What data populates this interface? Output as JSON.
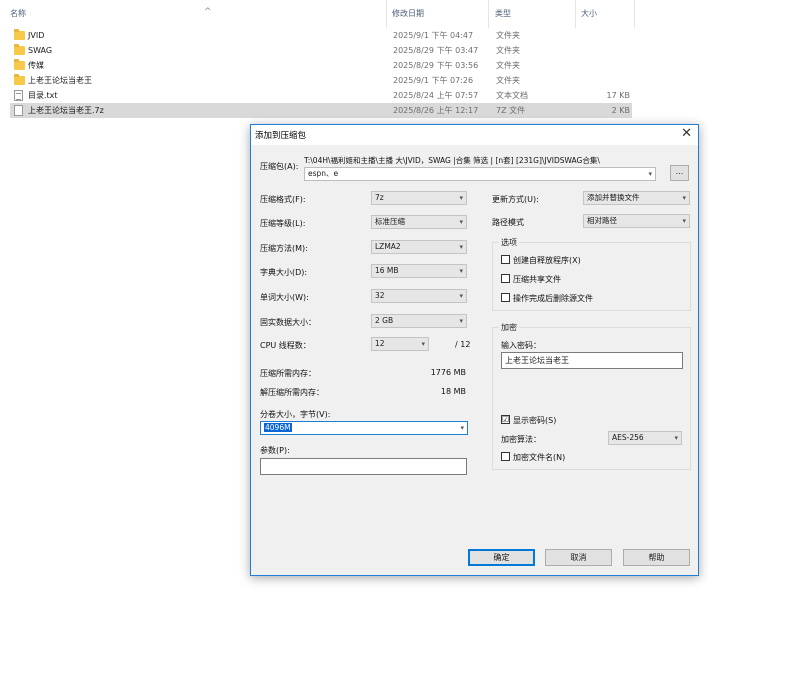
{
  "explorer": {
    "columns": {
      "name": "名称",
      "date": "修改日期",
      "type": "类型",
      "size": "大小"
    },
    "files": [
      {
        "name": "JVID",
        "date": "2025/9/1 下午 04:47",
        "type": "文件夹",
        "size": "",
        "icon": "folder-icon"
      },
      {
        "name": "SWAG",
        "date": "2025/8/29 下午 03:47",
        "type": "文件夹",
        "size": "",
        "icon": "folder-icon"
      },
      {
        "name": "传媒",
        "date": "2025/8/29 下午 03:56",
        "type": "文件夹",
        "size": "",
        "icon": "folder-icon"
      },
      {
        "name": "上老王论坛当老王",
        "date": "2025/9/1 下午 07:26",
        "type": "文件夹",
        "size": "",
        "icon": "folder-icon"
      },
      {
        "name": "目录.txt",
        "date": "2025/8/24 上午 07:57",
        "type": "文本文档",
        "size": "17 KB",
        "icon": "text-file-icon"
      },
      {
        "name": "上老王论坛当老王.7z",
        "date": "2025/8/26 上午 12:17",
        "type": "7Z 文件",
        "size": "2 KB",
        "icon": "archive-file-icon",
        "selected": true
      }
    ]
  },
  "dialog": {
    "title": "添加到压缩包",
    "archive_label": "压缩包(A):",
    "archive_path": "T:\\04H\\福利姬和主播\\主播 大\\JVID，SWAG |合集 筛选 | [n套] [231G]\\JVIDSWAG合集\\",
    "archive_name": "espn、e",
    "browse_label": "...",
    "format_label": "压缩格式(F):",
    "format_value": "7z",
    "level_label": "压缩等级(L):",
    "level_value": "标准压缩",
    "method_label": "压缩方法(M):",
    "method_value": "LZMA2",
    "dict_label": "字典大小(D):",
    "dict_value": "16 MB",
    "word_label": "单词大小(W):",
    "word_value": "32",
    "solid_label": "固实数据大小：",
    "solid_value": "2 GB",
    "cpu_label": "CPU 线程数：",
    "cpu_value": "12",
    "cpu_total": "/ 12",
    "mem_comp_label": "压缩所需内存：",
    "mem_comp_value": "1776 MB",
    "mem_decomp_label": "解压缩所需内存：",
    "mem_decomp_value": "18 MB",
    "volume_label": "分卷大小，字节(V):",
    "volume_value": "4096M",
    "params_label": "参数(P):",
    "params_value": "",
    "update_label": "更新方式(U):",
    "update_value": "添加并替换文件",
    "pathmode_label": "路径模式",
    "pathmode_value": "相对路径",
    "options_title": "选项",
    "opt_sfx": "创建自释放程序(X)",
    "opt_shared": "压缩共享文件",
    "opt_delete": "操作完成后删除源文件",
    "encrypt_title": "加密",
    "password_label": "输入密码：",
    "password_value": "上老王论坛当老王",
    "show_password": "显示密码(S)",
    "show_password_check": "☑",
    "encrypt_method_label": "加密算法：",
    "encrypt_method_value": "AES-256",
    "encrypt_names": "加密文件名(N)",
    "ok": "确定",
    "cancel": "取消",
    "help": "帮助",
    "close_glyph": "✕"
  }
}
